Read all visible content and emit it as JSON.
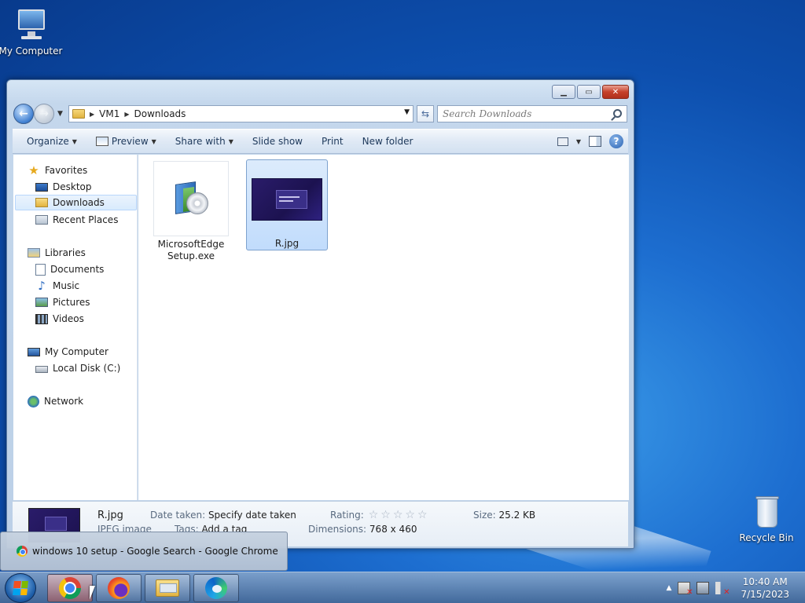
{
  "desktop": {
    "icons": [
      {
        "label": "My Computer"
      },
      {
        "label": "Recycle Bin"
      }
    ]
  },
  "explorer": {
    "breadcrumb": [
      "VM1",
      "Downloads"
    ],
    "search_placeholder": "Search Downloads",
    "toolbar": {
      "organize": "Organize",
      "preview": "Preview",
      "share_with": "Share with",
      "slide_show": "Slide show",
      "print": "Print",
      "new_folder": "New folder"
    },
    "nav": {
      "favorites": "Favorites",
      "desktop": "Desktop",
      "downloads": "Downloads",
      "recent_places": "Recent Places",
      "libraries": "Libraries",
      "documents": "Documents",
      "music": "Music",
      "pictures": "Pictures",
      "videos": "Videos",
      "my_computer": "My Computer",
      "local_disk": "Local Disk (C:)",
      "network": "Network"
    },
    "files": [
      {
        "name": "MicrosoftEdgeSetup.exe"
      },
      {
        "name": "R.jpg"
      }
    ],
    "details": {
      "filename": "R.jpg",
      "filetype": "JPEG image",
      "date_taken_label": "Date taken:",
      "date_taken_value": "Specify date taken",
      "tags_label": "Tags:",
      "tags_value": "Add a tag",
      "rating_label": "Rating:",
      "rating_stars": 0,
      "dimensions_label": "Dimensions:",
      "dimensions_value": "768 x 460",
      "size_label": "Size:",
      "size_value": "25.2 KB"
    }
  },
  "taskbar": {
    "tooltip": "windows 10 setup - Google Search - Google Chrome",
    "clock_time": "10:40 AM",
    "clock_date": "7/15/2023"
  }
}
